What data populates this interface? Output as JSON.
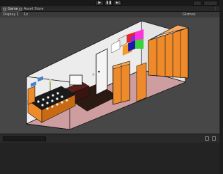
{
  "toolbar": {
    "play_icon": "play-icon",
    "pause_icon": "pause-icon",
    "step_icon": "step-icon"
  },
  "tabs": [
    {
      "label": "Game",
      "icon": "game-icon",
      "active": true
    },
    {
      "label": "Asset Store",
      "icon": "store-icon",
      "active": false
    }
  ],
  "tab_menu": "⋮",
  "scene": {
    "display": "Display 1",
    "scale": "1x",
    "gizmos_label": "Gizmos"
  },
  "bottom_panel": {
    "search_placeholder": ""
  },
  "colors": {
    "floor": "#cd9da0",
    "wall": "#ececec",
    "door_orange": "#ee8a2a",
    "rug": "#2a1a12"
  }
}
